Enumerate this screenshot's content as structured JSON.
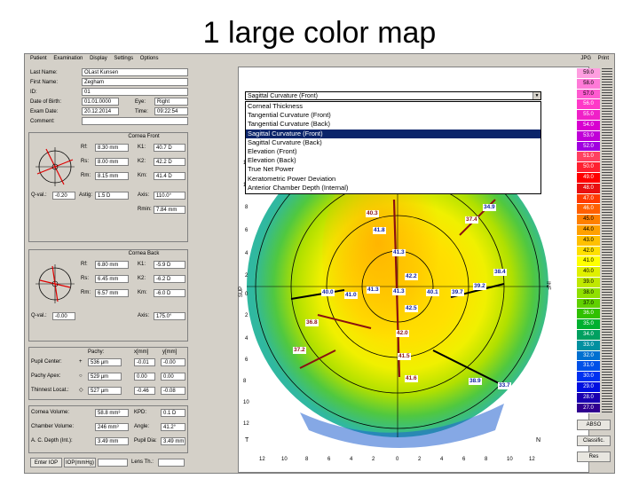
{
  "slide": {
    "title": "1 large color map"
  },
  "menu": {
    "items": [
      "Patient",
      "Examination",
      "Display",
      "Settings",
      "Options"
    ],
    "right": [
      "JPG",
      "Print"
    ]
  },
  "patient": {
    "fields": [
      {
        "label": "Last Name:",
        "value": "OLast Kunsen"
      },
      {
        "label": "First Name:",
        "value": "Zegham"
      },
      {
        "label": "ID:",
        "value": "01"
      },
      {
        "label": "Date of Birth:",
        "value": "01.01.0000"
      },
      {
        "label": "Exam Date:",
        "value": "20.12.2014"
      },
      {
        "label": "Comment:",
        "value": ""
      }
    ],
    "eye_label": "Eye:",
    "eye_value": "Right",
    "time_label": "Time:",
    "time_value": "09:22:54"
  },
  "cornea_front": {
    "title": "Cornea Front",
    "rows": [
      {
        "l1": "Rf:",
        "v1": "8.30 mm",
        "l2": "K1:",
        "v2": "40.7 D"
      },
      {
        "l1": "Rs:",
        "v1": "8.00 mm",
        "l2": "K2:",
        "v2": "42.2 D"
      },
      {
        "l1": "Rm:",
        "v1": "8.15 mm",
        "l2": "Km:",
        "v2": "41.4 D"
      },
      {
        "l1": "Q-val.:",
        "v1": "-0.20",
        "l2": "Axis:",
        "v2": "110.0°"
      }
    ],
    "extra": [
      {
        "l1": "Astig:",
        "v1": "1.5 D",
        "l2": "Rmin:",
        "v2": "7.84 mm"
      }
    ]
  },
  "cornea_back": {
    "title": "Cornea Back",
    "rows": [
      {
        "l1": "Rf:",
        "v1": "6.80 mm",
        "l2": "K1:",
        "v2": "-5.9 D"
      },
      {
        "l1": "Rs:",
        "v1": "6.45 mm",
        "l2": "K2:",
        "v2": "-6.2 D"
      },
      {
        "l1": "Rm:",
        "v1": "6.57 mm",
        "l2": "Km:",
        "v2": "-6.0 D"
      },
      {
        "l1": "Q-val.:",
        "v1": "-0.00",
        "l2": "Axis:",
        "v2": "175.0°"
      }
    ]
  },
  "pachy": {
    "headers": [
      "Pachy:",
      "x[mm]",
      "y[mm]"
    ],
    "rows": [
      {
        "label": "Pupil Center:",
        "sym": "+",
        "v": "536 µm",
        "x": "-0.01",
        "y": "-0.00"
      },
      {
        "label": "Pachy Apex:",
        "sym": "○",
        "v": "529 µm",
        "x": "0.00",
        "y": "0.00"
      },
      {
        "label": "Thinnest Locat.:",
        "sym": "◇",
        "v": "527 µm",
        "x": "-0.46",
        "y": "-0.08"
      }
    ]
  },
  "chamber": {
    "rows": [
      {
        "l1": "Cornea Volume:",
        "v1": "58.8 mm³",
        "l2": "KPD:",
        "v2": "0.1 D"
      },
      {
        "l1": "Chamber Volume:",
        "v1": "246 mm³",
        "l2": "Angle:",
        "v2": "41.2°"
      },
      {
        "l1": "A. C. Depth (Int.):",
        "v1": "3.49 mm",
        "l2": "Pupil Dia:",
        "v2": "3.49 mm"
      }
    ]
  },
  "bottom_buttons": [
    "Enter IOP",
    "IOP(mmHg)",
    "Lens Th.:"
  ],
  "dropdown": {
    "selected": "Sagittal Curvature (Front)",
    "options": [
      "Corneal Thickness",
      "Tangential Curvature (Front)",
      "Tangential Curvature (Back)",
      "Sagittal Curvature (Front)",
      "Sagittal Curvature (Back)",
      "Elevation (Front)",
      "Elevation (Back)",
      "True Net Power",
      "Keratometric Power Deviation",
      "Anterior Chamber Depth (Internal)"
    ],
    "highlighted_index": 3
  },
  "map": {
    "labels": [
      {
        "text": "40.3",
        "color": "red"
      },
      {
        "text": "41.8",
        "color": "blue"
      },
      {
        "text": "34.9",
        "color": "blue"
      },
      {
        "text": "37.4",
        "color": "red"
      },
      {
        "text": "41.3",
        "color": "blue"
      },
      {
        "text": "42.2",
        "color": "blue"
      },
      {
        "text": "38.4",
        "color": "blue"
      },
      {
        "text": "40.0",
        "color": "blue"
      },
      {
        "text": "41.0",
        "color": "blue"
      },
      {
        "text": "41.3",
        "color": "blue"
      },
      {
        "text": "41.3",
        "color": "blue"
      },
      {
        "text": "40.1",
        "color": "blue"
      },
      {
        "text": "39.7",
        "color": "blue"
      },
      {
        "text": "39.2",
        "color": "blue"
      },
      {
        "text": "42.5",
        "color": "blue"
      },
      {
        "text": "36.8",
        "color": "red"
      },
      {
        "text": "42.0",
        "color": "red"
      },
      {
        "text": "37.2",
        "color": "red"
      },
      {
        "text": "41.5",
        "color": "red"
      },
      {
        "text": "41.6",
        "color": "red"
      },
      {
        "text": "38.9",
        "color": "blue"
      },
      {
        "text": "33.7",
        "color": "blue"
      }
    ],
    "y_ticks": [
      "12",
      "10",
      "8",
      "6",
      "4",
      "2",
      "0",
      "2",
      "4",
      "6",
      "8",
      "10",
      "12"
    ],
    "x_ticks": [
      "12",
      "10",
      "8",
      "6",
      "4",
      "2",
      "0",
      "2",
      "4",
      "6",
      "8",
      "10",
      "12"
    ],
    "corner_t": "T",
    "corner_n": "N",
    "axis_sup": "SUP",
    "axis_inf": "INF"
  },
  "scale": {
    "values": [
      "59.0",
      "58.0",
      "57.0",
      "56.0",
      "55.0",
      "54.0",
      "53.0",
      "52.0",
      "51.0",
      "50.0",
      "49.0",
      "48.0",
      "47.0",
      "46.0",
      "45.0",
      "44.0",
      "43.0",
      "42.0",
      "41.0",
      "40.0",
      "39.0",
      "38.0",
      "37.0",
      "36.0",
      "35.0",
      "34.0",
      "33.0",
      "32.0",
      "31.0",
      "30.0",
      "29.0",
      "28.0",
      "27.0"
    ],
    "colors": [
      "#ff9ee0",
      "#ff7ad8",
      "#ff5ad0",
      "#ff38c8",
      "#f020c8",
      "#d800d0",
      "#c000d8",
      "#a000e0",
      "#ff4060",
      "#ff2030",
      "#ff0000",
      "#e81010",
      "#ff3a00",
      "#ff6000",
      "#ff8000",
      "#ffa000",
      "#ffc000",
      "#ffe000",
      "#ffff00",
      "#e0f000",
      "#c0e800",
      "#90e000",
      "#60d000",
      "#30c000",
      "#00b030",
      "#00a060",
      "#0090a0",
      "#0070d0",
      "#0050e8",
      "#0030f0",
      "#0010e0",
      "#1a00b0",
      "#300090"
    ],
    "buttons": [
      "ABSO",
      "Classific.",
      "Res"
    ]
  }
}
